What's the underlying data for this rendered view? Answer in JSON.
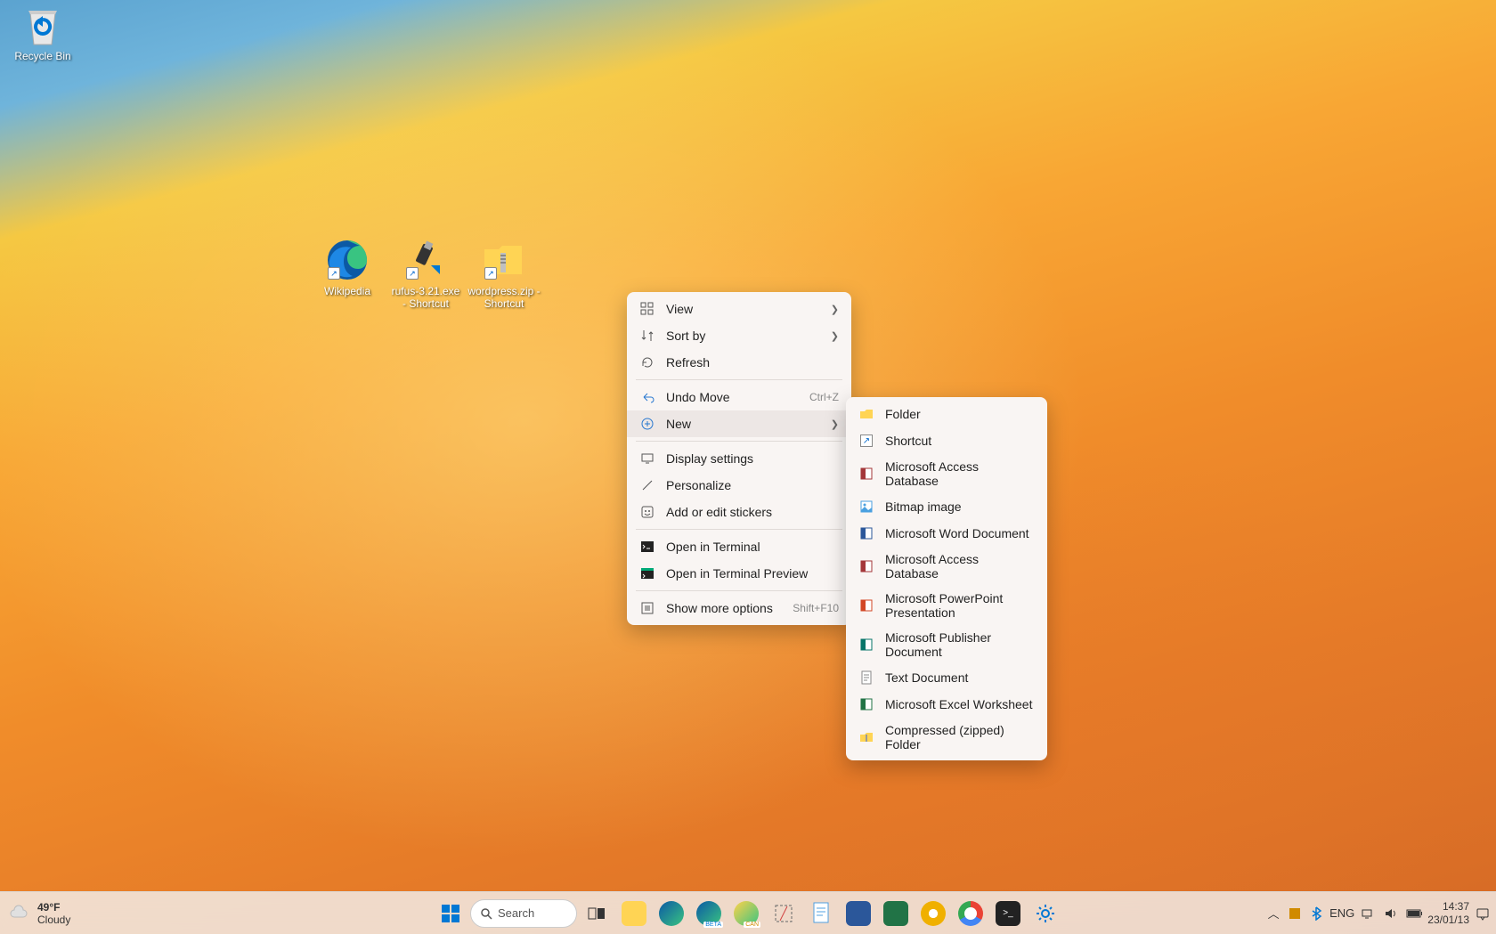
{
  "desktop_icons": {
    "recycle_bin": "Recycle Bin",
    "wikipedia": "Wikipedia",
    "rufus": "rufus-3.21.exe - Shortcut",
    "wordpress": "wordpress.zip - Shortcut"
  },
  "context_menu": {
    "view": "View",
    "sort_by": "Sort by",
    "refresh": "Refresh",
    "undo_move": "Undo Move",
    "undo_accel": "Ctrl+Z",
    "new": "New",
    "display_settings": "Display settings",
    "personalize": "Personalize",
    "stickers": "Add or edit stickers",
    "open_terminal": "Open in Terminal",
    "open_terminal_preview": "Open in Terminal Preview",
    "show_more": "Show more options",
    "show_more_accel": "Shift+F10"
  },
  "new_submenu": {
    "folder": "Folder",
    "shortcut": "Shortcut",
    "access_db": "Microsoft Access Database",
    "bitmap": "Bitmap image",
    "word": "Microsoft Word Document",
    "access_db2": "Microsoft Access Database",
    "powerpoint": "Microsoft PowerPoint Presentation",
    "publisher": "Microsoft Publisher Document",
    "text": "Text Document",
    "excel": "Microsoft Excel Worksheet",
    "zip": "Compressed (zipped) Folder"
  },
  "taskbar": {
    "search_label": "Search",
    "weather_temp": "49°F",
    "weather_cond": "Cloudy",
    "lang": "ENG",
    "time": "14:37",
    "date": "23/01/13"
  }
}
